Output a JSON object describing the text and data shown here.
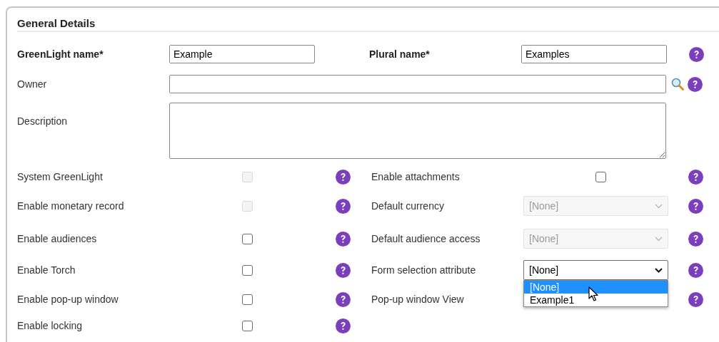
{
  "section": {
    "title": "General Details"
  },
  "name_row": [
    {
      "label": "GreenLight name*",
      "value": "Example"
    },
    {
      "label": "Plural name*",
      "value": "Examples"
    }
  ],
  "owner": {
    "label": "Owner"
  },
  "description": {
    "label": "Description"
  },
  "rows": [
    {
      "left": {
        "label": "System GreenLight",
        "kind": "checkbox",
        "checked": false,
        "disabled": true
      },
      "right": {
        "label": "Enable attachments",
        "kind": "checkbox",
        "checked": false,
        "disabled": false
      }
    },
    {
      "left": {
        "label": "Enable monetary record",
        "kind": "checkbox",
        "checked": false,
        "disabled": true
      },
      "right": {
        "label": "Default currency",
        "kind": "select",
        "value": "[None]",
        "disabled": true
      }
    },
    {
      "left": {
        "label": "Enable audiences",
        "kind": "checkbox",
        "checked": false,
        "disabled": false
      },
      "right": {
        "label": "Default audience access",
        "kind": "select",
        "value": "[None]",
        "disabled": true
      }
    },
    {
      "left": {
        "label": "Enable Torch",
        "kind": "checkbox",
        "checked": false,
        "disabled": false
      },
      "right": {
        "label": "Form selection attribute",
        "kind": "select",
        "value": "[None]",
        "disabled": false,
        "expanded": true,
        "options": [
          {
            "label": "[None]",
            "selected": true
          },
          {
            "label": "Example1",
            "selected": false
          }
        ]
      }
    },
    {
      "left": {
        "label": "Enable pop-up window",
        "kind": "checkbox",
        "checked": false,
        "disabled": false
      },
      "right": {
        "label": "Pop-up window View",
        "kind": "covered"
      }
    },
    {
      "left": {
        "label": "Enable locking",
        "kind": "checkbox",
        "checked": false,
        "disabled": false
      }
    }
  ]
}
